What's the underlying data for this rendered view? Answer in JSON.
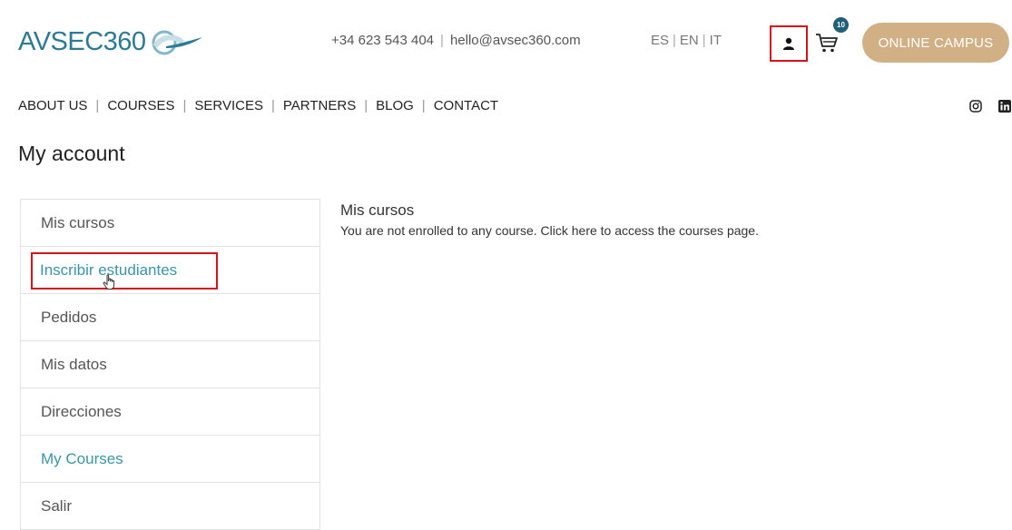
{
  "header": {
    "logo_text": "AVSEC360",
    "phone": "+34 623 543 404",
    "email": "hello@avsec360.com",
    "languages": [
      "ES",
      "EN",
      "IT"
    ],
    "cart_count": "10",
    "campus_label": "ONLINE CAMPUS",
    "icons": {
      "user": "user-icon",
      "cart": "cart-icon",
      "instagram": "instagram-icon",
      "linkedin": "linkedin-icon"
    }
  },
  "nav": {
    "items": [
      "ABOUT US",
      "COURSES",
      "SERVICES",
      "PARTNERS",
      "BLOG",
      "CONTACT"
    ]
  },
  "page": {
    "title": "My account"
  },
  "sidebar": {
    "items": [
      {
        "label": "Mis cursos"
      },
      {
        "label": "Inscribir estudiantes"
      },
      {
        "label": "Pedidos"
      },
      {
        "label": "Mis datos"
      },
      {
        "label": "Direcciones"
      },
      {
        "label": "My Courses"
      },
      {
        "label": "Salir"
      }
    ]
  },
  "main": {
    "heading": "Mis cursos",
    "message": "You are not enrolled to any course. Click here to access the courses page."
  },
  "colors": {
    "brand": "#2c7a93",
    "accent": "#3a95a8",
    "campus_button": "#d2b086",
    "highlight": "#d4141b",
    "badge": "#1f5f78"
  }
}
